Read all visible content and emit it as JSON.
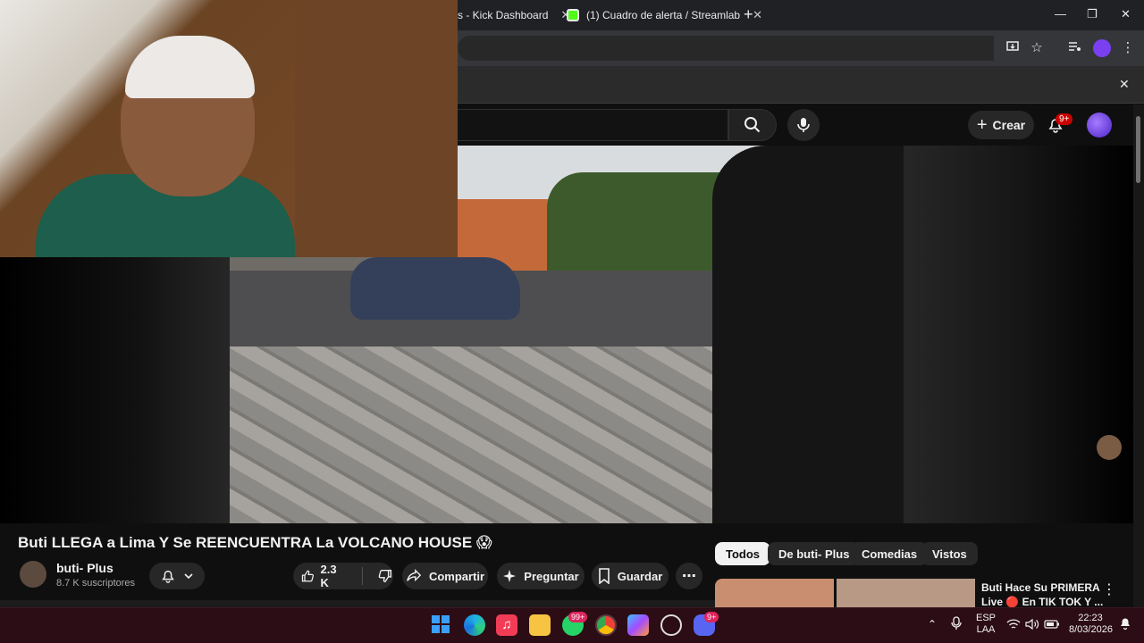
{
  "browser": {
    "tabs": [
      {
        "label": "s - Kick Dashboard"
      },
      {
        "label": "(1) Cuadro de alerta / Streamlab"
      }
    ],
    "close_glyph": "✕",
    "new_tab_glyph": "+",
    "window_controls": [
      "—",
      "❐",
      "✕"
    ],
    "infobar_close": "✕"
  },
  "youtube": {
    "create_label": "Crear",
    "notifications_badge": "9+",
    "video_title": "Buti LLEGA a Lima Y Se REENCUENTRA La VOLCANO HOUSE 😱",
    "channel_name": "buti- Plus",
    "channel_subs": "8.7 K suscriptores",
    "like_count": "2.3 K",
    "share_label": "Compartir",
    "ask_label": "Preguntar",
    "save_label": "Guardar",
    "chips": [
      "Todos",
      "De buti- Plus",
      "Comedias",
      "Vistos"
    ],
    "recommendation": {
      "title_line1": "Buti Hace Su PRIMERA",
      "title_line2": "Live 🔴 En TIK TOK Y ..."
    }
  },
  "taskbar": {
    "whatsapp_badge": "99+",
    "discord_badge": "9+",
    "lang_line1": "ESP",
    "lang_line2": "LAA",
    "time": "22:23",
    "date": "8/03/2026"
  },
  "colors": {
    "accent_red": "#cc0000",
    "taskbar": "#2c0d15",
    "kick_green": "#53fc18"
  }
}
